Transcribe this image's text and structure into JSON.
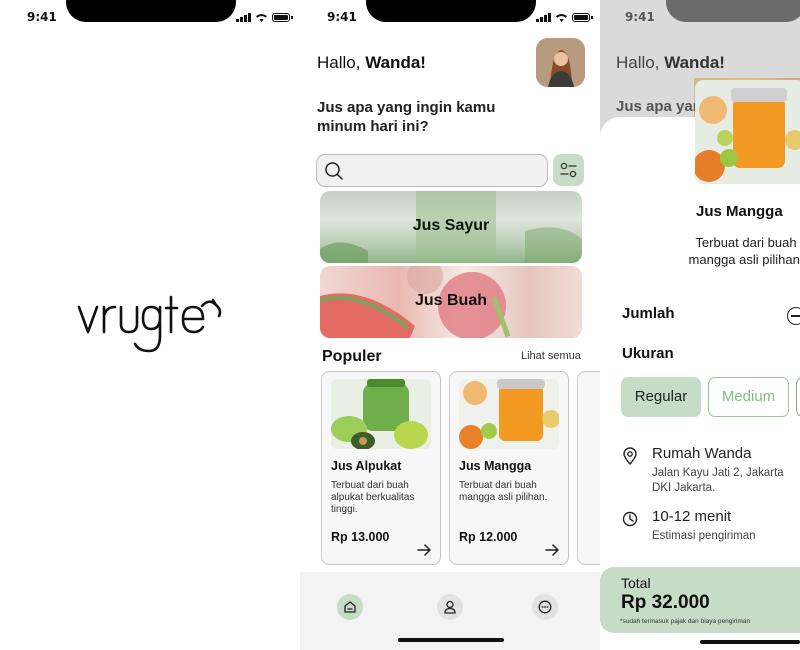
{
  "status": {
    "time": "9:41"
  },
  "splash": {
    "logo_text": "vrugte"
  },
  "home": {
    "greeting_prefix": "Hallo, ",
    "greeting_name": "Wanda!",
    "prompt": "Jus apa yang ingin kamu minum hari ini?",
    "search": {
      "placeholder": ""
    },
    "categories": [
      {
        "label": "Jus Sayur"
      },
      {
        "label": "Jus Buah"
      }
    ],
    "popular_title": "Populer",
    "see_all": "Lihat semua",
    "products": [
      {
        "name": "Jus Alpukat",
        "desc": "Terbuat dari buah alpukat berkualitas tinggi.",
        "price": "Rp 13.000"
      },
      {
        "name": "Jus Mangga",
        "desc": "Terbuat dari buah mangga asli pilihan.",
        "price": "Rp 12.000"
      }
    ]
  },
  "detail": {
    "dim_greeting_prefix": "Hallo, ",
    "dim_greeting_name": "Wanda!",
    "dim_prompt": "Jus apa yang",
    "name": "Jus Mangga",
    "desc": "Terbuat dari buah mangga asli pilihan.",
    "qty_label": "Jumlah",
    "size_label": "Ukuran",
    "sizes": [
      "Regular",
      "Medium"
    ],
    "selected_size": "Regular",
    "address_title": "Rumah Wanda",
    "address_line1": "Jalan Kayu Jati 2, Jakarta",
    "address_line2": "DKI Jakarta.",
    "eta_title": "10-12 menit",
    "eta_sub": "Estimasi pengiriman",
    "total_label": "Total",
    "total_value": "Rp 32.000",
    "total_note": "*sudah termasuk pajak dan biaya pengiriman"
  },
  "colors": {
    "accent": "#c6dcc6",
    "accent_text": "#7fbf7f"
  },
  "icons": [
    "search-icon",
    "filter-icon",
    "arrow-right-icon",
    "home-icon",
    "user-icon",
    "chat-icon",
    "location-pin-icon",
    "clock-icon",
    "minus-icon"
  ]
}
